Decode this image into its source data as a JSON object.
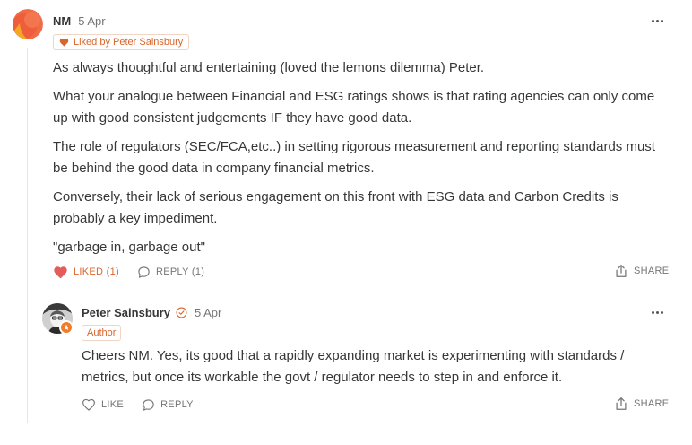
{
  "comment": {
    "author": "NM",
    "date": "5 Apr",
    "liked_badge": "Liked by Peter Sainsbury",
    "paragraphs": [
      "As always thoughtful and entertaining (loved the lemons dilemma) Peter.",
      "What your analogue between Financial and ESG ratings shows is that rating agencies can only come up with good consistent judgements IF they have good data.",
      "The role of regulators (SEC/FCA,etc..) in setting rigorous measurement and reporting standards must be behind the good data in company financial metrics.",
      "Conversely, their lack of serious engagement on this front with ESG data and Carbon Credits is probably a key impediment.",
      "\"garbage in, garbage out\""
    ],
    "actions": {
      "like_label": "LIKED (1)",
      "reply_label": "REPLY (1)",
      "share_label": "SHARE"
    },
    "avatar_colors": {
      "background": "#f26b47",
      "accent": "#f5a623"
    }
  },
  "reply": {
    "author": "Peter Sainsbury",
    "date": "5 Apr",
    "author_tag": "Author",
    "text": "Cheers NM. Yes, its good that a rapidly expanding market is experimenting with standards / metrics, but once its workable the govt / regulator needs to step in and enforce it.",
    "actions": {
      "like_label": "LIKE",
      "reply_label": "REPLY",
      "share_label": "SHARE"
    }
  },
  "colors": {
    "accent": "#d9652b",
    "heart": "#e25c5c",
    "text": "#363737",
    "muted": "#757575"
  },
  "icons": [
    "heart-icon",
    "comment-bubble-icon",
    "share-icon",
    "more-dots-icon",
    "verified-check-icon",
    "star-badge-icon"
  ]
}
